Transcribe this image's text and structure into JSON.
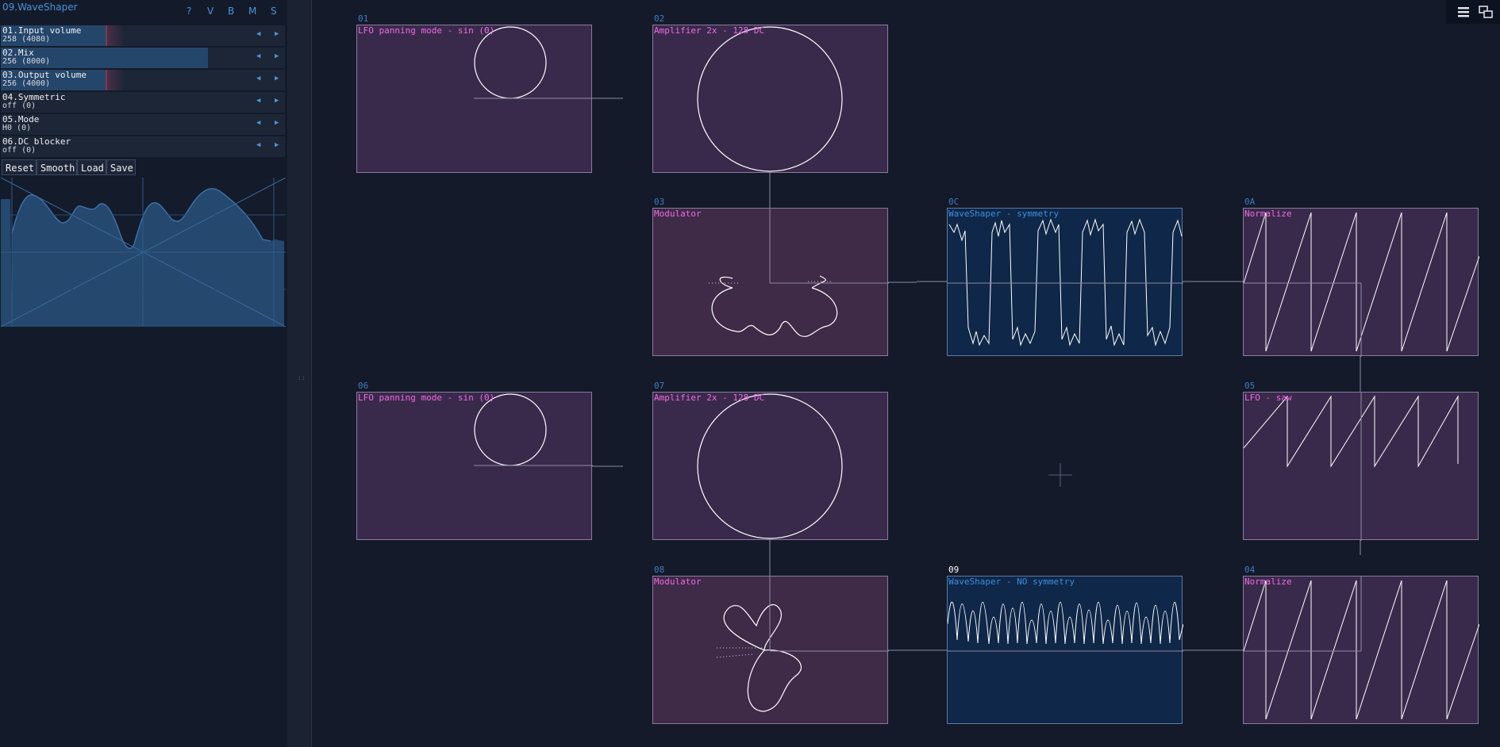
{
  "panel": {
    "title": "09.WaveShaper",
    "header_buttons": [
      "?",
      "V",
      "B",
      "M",
      "S"
    ],
    "params": [
      {
        "name": "01.Input volume",
        "value": "258 (4080)",
        "fill": 0.37,
        "style": "red"
      },
      {
        "name": "02.Mix",
        "value": "256 (8000)",
        "fill": 0.73,
        "style": "plain"
      },
      {
        "name": "03.Output volume",
        "value": "256 (4000)",
        "fill": 0.37,
        "style": "red"
      },
      {
        "name": "04.Symmetric",
        "value": "off (0)",
        "fill": 0,
        "style": "none"
      },
      {
        "name": "05.Mode",
        "value": "H0 (0)",
        "fill": 0,
        "style": "none"
      },
      {
        "name": "06.DC blocker",
        "value": "off (0)",
        "fill": 0,
        "style": "none"
      }
    ],
    "arrow_left": "◀",
    "arrow_right": "▶",
    "buttons": {
      "reset": "Reset",
      "smooth": "Smooth",
      "load": "Load",
      "save": "Save"
    },
    "rail_handle": "::"
  },
  "nodes": [
    {
      "id": "01",
      "label": "LFO panning mode - sin (0)",
      "kind": "mag"
    },
    {
      "id": "02",
      "label": "Amplifier 2x - 128 DC",
      "kind": "mag"
    },
    {
      "id": "03",
      "label": "Modulator",
      "kind": "mod"
    },
    {
      "id": "0C",
      "label": "WaveShaper - symmetry",
      "kind": "blu"
    },
    {
      "id": "0A",
      "label": "Normalize",
      "kind": "mag"
    },
    {
      "id": "06",
      "label": "LFO panning mode - sin (0)",
      "kind": "mag"
    },
    {
      "id": "07",
      "label": "Amplifier 2x - 128 DC",
      "kind": "mag"
    },
    {
      "id": "05",
      "label": "LFO - saw",
      "kind": "mag"
    },
    {
      "id": "08",
      "label": "Modulator",
      "kind": "mod"
    },
    {
      "id": "09",
      "label": "WaveShaper - NO symmetry",
      "kind": "blu"
    },
    {
      "id": "04",
      "label": "Normalize",
      "kind": "mag"
    }
  ],
  "colors": {
    "background": "#141a29",
    "accent_blue": "#4d93d8",
    "node_label_magenta": "#f06ae4",
    "node_fill_purple": "#392a4b",
    "node_fill_blue": "#0f2748"
  },
  "icons": {
    "menu": "hamburger-menu-icon",
    "windows": "windows-icon",
    "crosshair": "crosshair-icon"
  }
}
